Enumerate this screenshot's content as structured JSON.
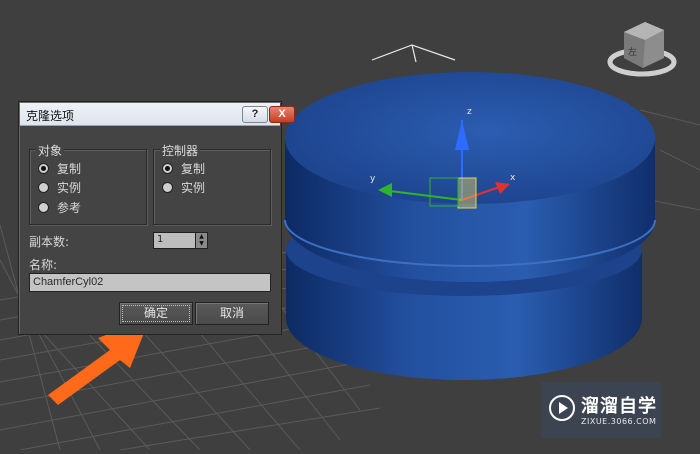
{
  "dialog": {
    "title": "克隆选项",
    "help_label": "?",
    "close_label": "X",
    "object_group": {
      "label": "对象",
      "options": [
        "复制",
        "实例",
        "参考"
      ],
      "selected": "复制"
    },
    "controller_group": {
      "label": "控制器",
      "options": [
        "复制",
        "实例"
      ],
      "selected": "复制"
    },
    "copies_label": "副本数:",
    "copies_value": "1",
    "name_label": "名称:",
    "name_value": "ChamferCyl02",
    "ok_label": "确定",
    "cancel_label": "取消"
  },
  "viewport": {
    "object_color": "#1f4a9a",
    "axes": {
      "x": "x",
      "y": "y",
      "z": "z"
    },
    "viewcube_face": "左"
  },
  "watermark": {
    "main": "溜溜自学",
    "sub": "ZIXUE.3066.COM"
  }
}
